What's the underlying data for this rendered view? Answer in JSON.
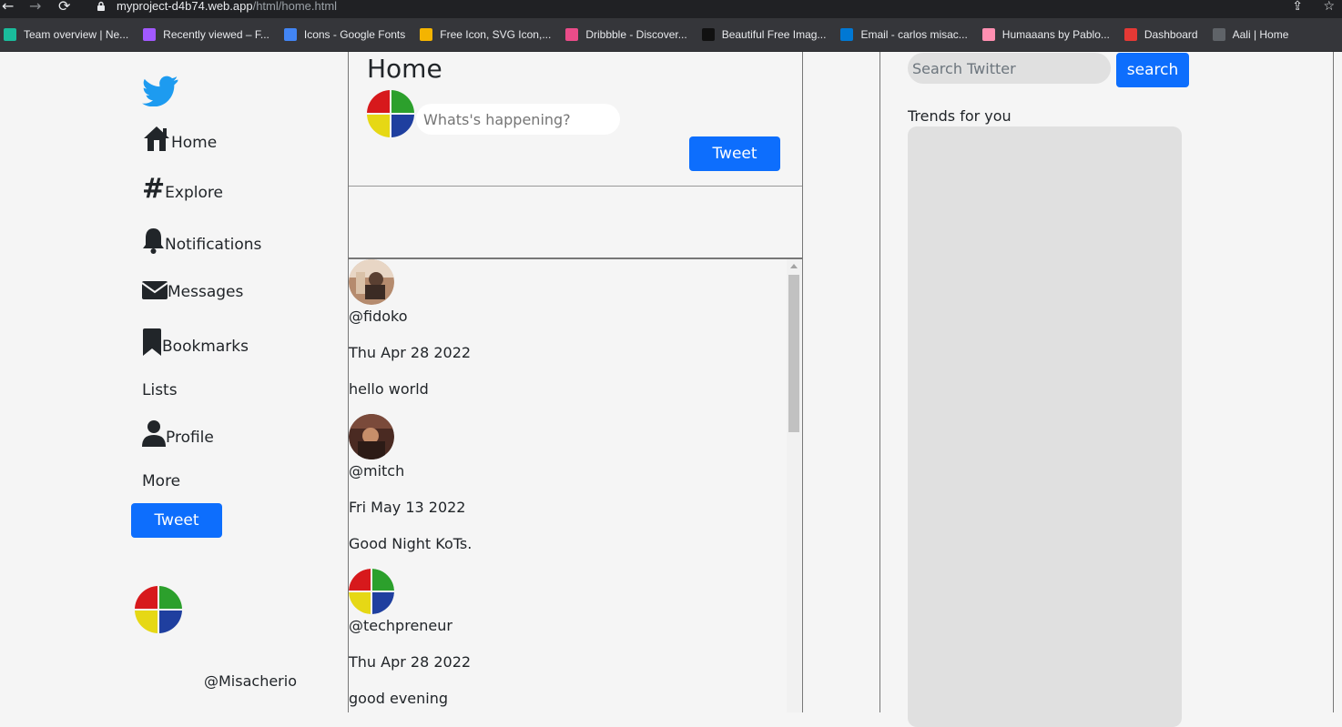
{
  "browser": {
    "url_host": "myproject-d4b74.web.app",
    "url_path": "/html/home.html",
    "back_glyph": "←",
    "forward_glyph": "→",
    "reload_glyph": "⟳",
    "share_glyph": "⇪",
    "star_glyph": "☆",
    "bookmarks": [
      {
        "label": "Team overview | Ne...",
        "color": "#1abc9c"
      },
      {
        "label": "Recently viewed – F...",
        "color": "#a259ff"
      },
      {
        "label": "Icons - Google Fonts",
        "color": "#4285f4"
      },
      {
        "label": "Free Icon, SVG Icon,...",
        "color": "#f4b400"
      },
      {
        "label": "Dribbble - Discover...",
        "color": "#ea4c89"
      },
      {
        "label": "Beautiful Free Imag...",
        "color": "#111111"
      },
      {
        "label": "Email - carlos misac...",
        "color": "#0078d4"
      },
      {
        "label": "Humaaans by Pablo...",
        "color": "#ff8fb1"
      },
      {
        "label": "Dashboard",
        "color": "#e53935"
      },
      {
        "label": "Aali | Home",
        "color": "#5f6368"
      }
    ]
  },
  "sidebar": {
    "items": [
      {
        "label": "Home",
        "icon": "home-icon"
      },
      {
        "label": "Explore",
        "icon": "hashtag-icon"
      },
      {
        "label": "Notifications",
        "icon": "bell-icon"
      },
      {
        "label": "Messages",
        "icon": "envelope-icon"
      },
      {
        "label": "Bookmarks",
        "icon": "bookmark-icon"
      },
      {
        "label": "Lists",
        "icon": ""
      },
      {
        "label": "Profile",
        "icon": "person-icon"
      },
      {
        "label": "More",
        "icon": ""
      }
    ],
    "tweet_label": "Tweet",
    "handle": "@Misacherio"
  },
  "compose": {
    "title": "Home",
    "placeholder": "Whats's happening?",
    "tweet_label": "Tweet"
  },
  "feed": {
    "posts": [
      {
        "handle": "@fidoko",
        "date": "Thu Apr 28 2022",
        "text": "hello world"
      },
      {
        "handle": "@mitch",
        "date": "Fri May 13 2022",
        "text": "Good Night KoTs."
      },
      {
        "handle": "@techpreneur",
        "date": "Thu Apr 28 2022",
        "text": "good evening"
      }
    ]
  },
  "right": {
    "search_placeholder": "Search Twitter",
    "search_label": "search",
    "trends_title": "Trends for you"
  },
  "colors": {
    "primary": "#0d6efd",
    "twitter_blue": "#1d9bf0",
    "avatar_red": "#d7191c",
    "avatar_green": "#2ca02c",
    "avatar_yellow": "#e6d815",
    "avatar_blue": "#1f3f9f"
  }
}
